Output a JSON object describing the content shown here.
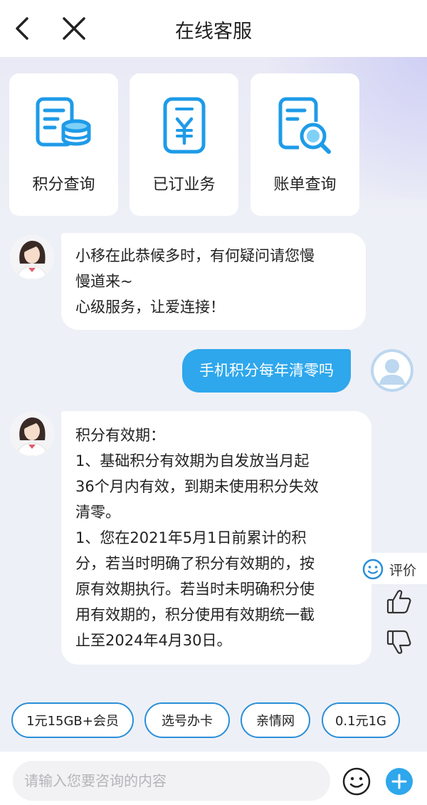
{
  "header": {
    "title": "在线客服"
  },
  "quick_cards": [
    {
      "label": "积分查询",
      "icon": "points-card-icon"
    },
    {
      "label": "已订业务",
      "icon": "yuan-bill-icon"
    },
    {
      "label": "账单查询",
      "icon": "bill-search-icon"
    }
  ],
  "messages": {
    "welcome": [
      "小移在此恭候多时，有何疑问请您慢",
      "慢道来~",
      "心级服务，让爱连接！"
    ],
    "user": "手机积分每年清零吗",
    "reply": [
      "积分有效期：",
      "1、基础积分有效期为自发放当月起",
      "36个月内有效，到期未使用积分失效",
      "清零。",
      "1、您在2021年5月1日前累计的积",
      "分，若当时明确了积分有效期的，按",
      "原有效期执行。若当时未明确积分使",
      "用有效期的，积分使用有效期统一截",
      "止至2024年4月30日。"
    ]
  },
  "rating": {
    "label": "评价"
  },
  "chips": [
    "1元15GB+会员",
    "选号办卡",
    "亲情网",
    "0.1元1G"
  ],
  "input": {
    "placeholder": "请输入您要咨询的内容"
  },
  "colors": {
    "accent": "#2ea7ec",
    "icon_blue": "#1e9be8"
  }
}
